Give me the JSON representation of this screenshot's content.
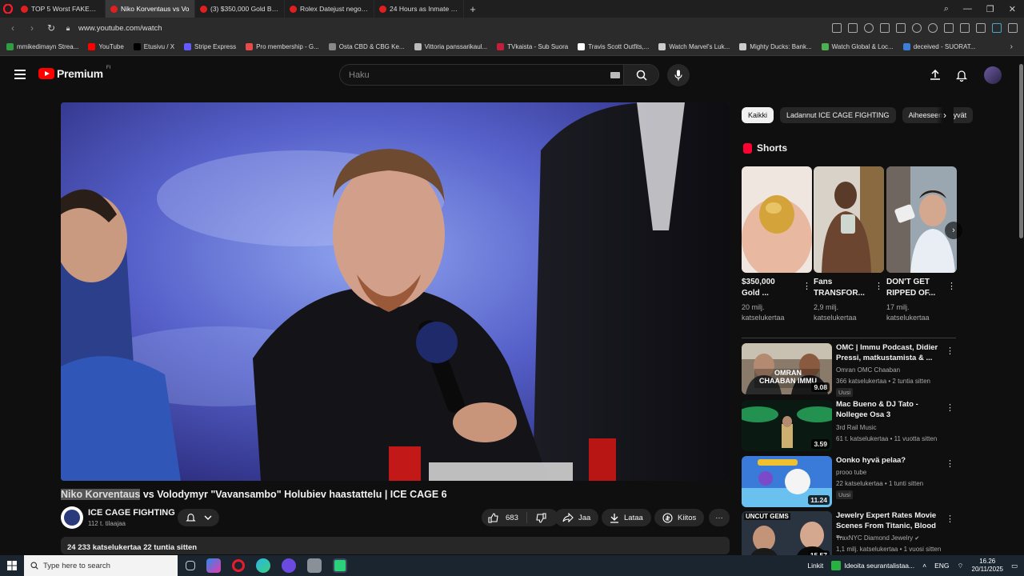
{
  "browser": {
    "tabs": [
      {
        "label": "TOP 5 Worst FAKES of ALL",
        "active": false
      },
      {
        "label": "Niko Korventaus vs Vo",
        "active": true
      },
      {
        "label": "(3) $350,000 Gold Baseball",
        "active": false
      },
      {
        "label": "Rolex Datejust negotiatio",
        "active": false
      },
      {
        "label": "24 Hours as Inmate in Ath",
        "active": false
      }
    ],
    "new_tab": "+",
    "url": "www.youtube.com/watch",
    "bookmarks": [
      {
        "label": "mmikedimayn Strea...",
        "color": "#2e9e40"
      },
      {
        "label": "YouTube",
        "color": "#ff0000"
      },
      {
        "label": "Etusivu / X",
        "color": "#000000"
      },
      {
        "label": "Stripe Express",
        "color": "#635bff"
      },
      {
        "label": "Pro membership - G...",
        "color": "#e84a4a"
      },
      {
        "label": "Osta CBD & CBG Ke...",
        "color": "#888888"
      },
      {
        "label": "Vittoria panssarikaul...",
        "color": "#bbbbbb"
      },
      {
        "label": "TVkaista - Sub Suora",
        "color": "#c41e3a"
      },
      {
        "label": "Travis Scott Outfits,...",
        "color": "#ffffff"
      },
      {
        "label": "Watch Marvel's Luk...",
        "color": "#cccccc"
      },
      {
        "label": "Mighty Ducks: Bank...",
        "color": "#cccccc"
      },
      {
        "label": "Watch Global & Loc...",
        "color": "#4caf50"
      },
      {
        "label": "deceived - SUORAT...",
        "color": "#3b7dd8"
      }
    ]
  },
  "youtube": {
    "brand": "Premium",
    "region": "FI",
    "search_placeholder": "Haku",
    "video": {
      "title_highlight": "Niko Korventaus",
      "title_rest": " vs Volodymyr \"Vavansambo\" Holubiev haastattelu | ICE CAGE 6",
      "channel": "ICE CAGE FIGHTING",
      "subscribers": "112 t. tilaajaa",
      "likes": "683",
      "share": "Jaa",
      "download": "Lataa",
      "thanks": "Kiitos",
      "more": "···",
      "description": "24 233 katselukertaa  22 tuntia sitten"
    },
    "chips": [
      {
        "label": "Kaikki",
        "active": true
      },
      {
        "label": "Ladannut ICE CAGE FIGHTING",
        "active": false
      },
      {
        "label": "Aiheeseen liittyvät",
        "active": false
      }
    ],
    "shorts": {
      "heading": "Shorts",
      "items": [
        {
          "title": "$350,000\nGold ...",
          "views": "20 milj.\nkatselukertaa"
        },
        {
          "title": "Fans\nTRANSFOR...",
          "views": "2,9 milj.\nkatselukertaa"
        },
        {
          "title": "DON'T GET\nRIPPED OF...",
          "views": "17 milj.\nkatselukertaa"
        }
      ]
    },
    "recommendations": [
      {
        "title": "OMC | Immu Podcast, Didier\nPressi, matkustamista & ...",
        "channel": "Omran OMC Chaaban",
        "meta": "366 katselukertaa • 2 tuntia sitten",
        "badge": "Uusi",
        "duration": "9.08",
        "thumb_text": "OMRAN CHAABAN IMMU"
      },
      {
        "title": "Mac Bueno & DJ Tato -\nNollegee Osa 3",
        "channel": "3rd Rail Music",
        "meta": "61 t. katselukertaa • 11 vuotta sitten",
        "badge": "",
        "duration": "3.59",
        "thumb_text": ""
      },
      {
        "title": "Oonko hyvä pelaa?",
        "channel": "prooo tube",
        "meta": "22 katselukertaa • 1 tunti sitten",
        "badge": "Uusi",
        "duration": "11.24",
        "thumb_text": ""
      },
      {
        "title": "Jewelry Expert Rates Movie\nScenes From Titanic, Blood ...",
        "channel": "TraxNYC Diamond Jewelry",
        "meta": "1,1 milj. katselukertaa • 1 vuosi sitten",
        "badge": "",
        "duration": "15.57",
        "thumb_text": "UNCUT GEMS"
      }
    ]
  },
  "taskbar": {
    "search_placeholder": "Type here to search",
    "links": "Linkit",
    "notification": "Ideoita seurantalistaa...",
    "lang": "ENG",
    "time": "16.26",
    "date": "20/11/2025"
  },
  "colors": {
    "accent": "#ff0000",
    "bg": "#0f0f0f",
    "chip": "#272727"
  }
}
